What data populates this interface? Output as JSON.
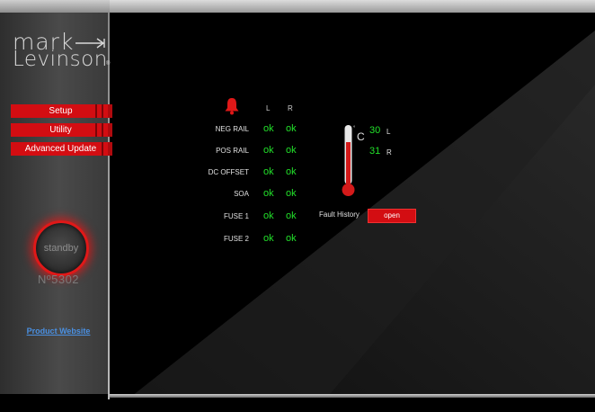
{
  "brand": {
    "line1": "mark",
    "line2": "Levinson",
    "reg": "®"
  },
  "sidebar": {
    "nav": [
      {
        "label": "Setup"
      },
      {
        "label": "Utility"
      },
      {
        "label": "Advanced Update"
      }
    ],
    "standby_label": "standby",
    "model_number": "Nº5302",
    "product_link": "Product Website"
  },
  "status": {
    "icon": "bell-icon",
    "col_left": "L",
    "col_right": "R",
    "rows": [
      {
        "label": "NEG RAIL",
        "left": "ok",
        "right": "ok"
      },
      {
        "label": "POS RAIL",
        "left": "ok",
        "right": "ok"
      },
      {
        "label": "DC OFFSET",
        "left": "ok",
        "right": "ok"
      },
      {
        "label": "SOA",
        "left": "ok",
        "right": "ok"
      },
      {
        "label": "FUSE 1",
        "left": "ok",
        "right": "ok"
      },
      {
        "label": "FUSE 2",
        "left": "ok",
        "right": "ok"
      }
    ]
  },
  "temperature": {
    "icon": "thermometer-icon",
    "degree": "°",
    "unit": "C",
    "left_value": "30",
    "left_label": "L",
    "right_value": "31",
    "right_label": "R"
  },
  "fault": {
    "label": "Fault History",
    "button": "open"
  },
  "colors": {
    "accent_red": "#d30d12",
    "ok_green": "#22e02a",
    "link_blue": "#4a90e2"
  }
}
